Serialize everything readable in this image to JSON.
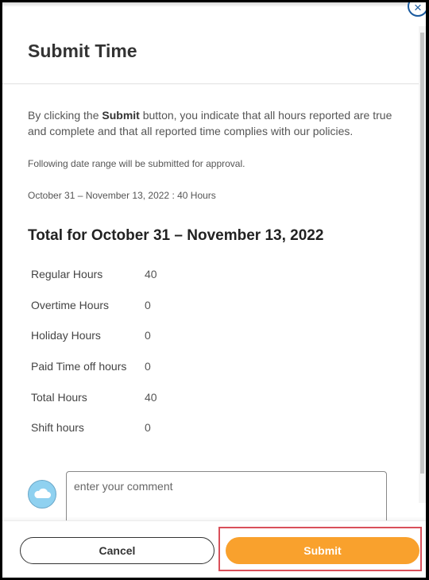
{
  "dialog": {
    "title": "Submit Time",
    "close_icon": "×",
    "intro": {
      "prefix": "By clicking the ",
      "bold": "Submit",
      "suffix": " button, you indicate that all hours reported are true and complete and that all reported time complies with our policies."
    },
    "note": "Following date range will be submitted for approval.",
    "range_summary": "October 31 – November 13, 2022 : 40 Hours",
    "total_title": "Total for October 31 – November 13, 2022",
    "hours": [
      {
        "label": "Regular Hours",
        "value": "40"
      },
      {
        "label": "Overtime Hours",
        "value": "0"
      },
      {
        "label": "Holiday Hours",
        "value": "0"
      },
      {
        "label": "Paid Time off hours",
        "value": "0"
      },
      {
        "label": "Total Hours",
        "value": "40"
      },
      {
        "label": "Shift hours",
        "value": "0"
      }
    ],
    "comment": {
      "placeholder": "enter your comment",
      "value": ""
    }
  },
  "footer": {
    "cancel_label": "Cancel",
    "submit_label": "Submit"
  },
  "colors": {
    "submit": "#f9a12d",
    "close": "#1a5a9e",
    "highlight": "#d9505a",
    "avatar": "#8fd1f0"
  }
}
